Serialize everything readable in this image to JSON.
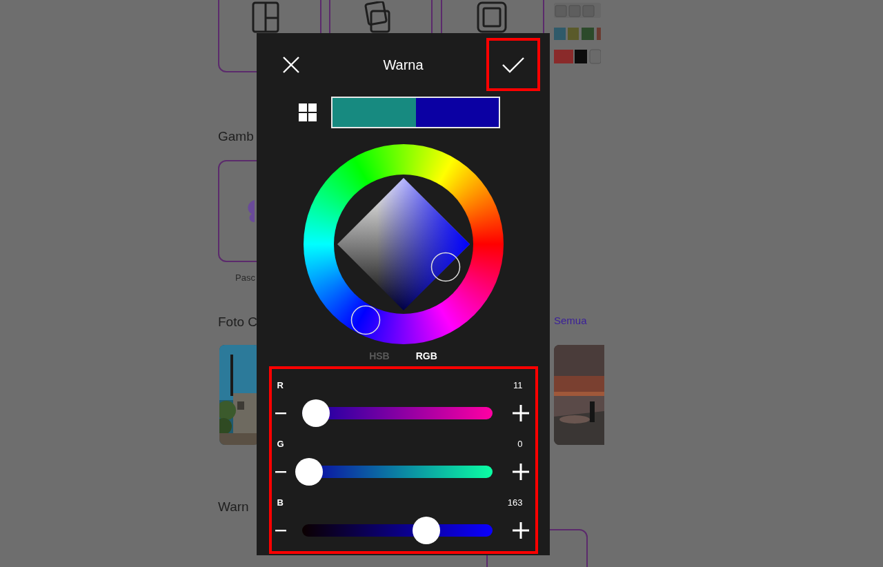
{
  "background_page": {
    "headings": [
      {
        "text": "Gamb"
      },
      {
        "text": "Foto C"
      },
      {
        "text": "Warn"
      }
    ],
    "card_caption": "Pasc",
    "see_all_link": "Semua"
  },
  "dialog": {
    "title": "Warna",
    "confirm_button": {
      "highlighted": true
    },
    "swatches": [
      {
        "color": "#178a80"
      },
      {
        "color": "#0b00a3"
      }
    ],
    "modes": [
      {
        "label": "HSB",
        "selected": false
      },
      {
        "label": "RGB",
        "selected": true
      }
    ],
    "channels_panel": {
      "highlighted": true
    },
    "channels": [
      {
        "label": "R",
        "value": "11",
        "level": 0.04
      },
      {
        "label": "G",
        "value": "0",
        "level": 0
      },
      {
        "label": "B",
        "value": "163",
        "level": 0.64
      }
    ]
  }
}
